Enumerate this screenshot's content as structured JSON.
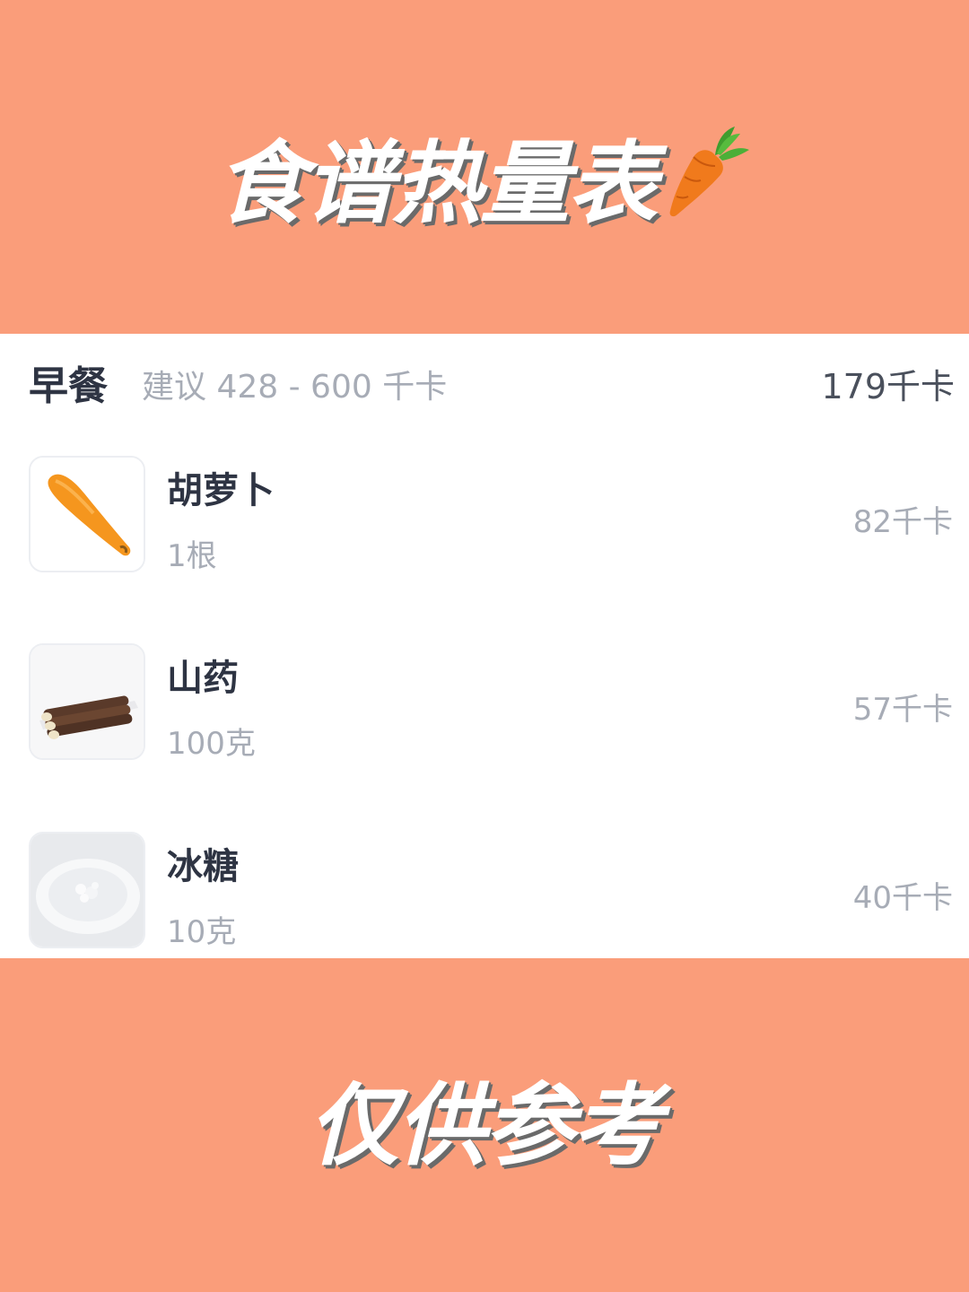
{
  "header": {
    "title": "食谱热量表",
    "title_icon": "carrot-icon"
  },
  "meal": {
    "name": "早餐",
    "suggestion": "建议 428 - 600 千卡",
    "total": "179千卡"
  },
  "foods": [
    {
      "name": "胡萝卜",
      "quantity": "1根",
      "calories": "82千卡",
      "image": "carrot-image"
    },
    {
      "name": "山药",
      "quantity": "100克",
      "calories": "57千卡",
      "image": "yam-image"
    },
    {
      "name": "冰糖",
      "quantity": "10克",
      "calories": "40千卡",
      "image": "rock-sugar-image"
    }
  ],
  "footer": {
    "text": "仅供参考"
  },
  "colors": {
    "background": "#fa9d7a",
    "panel": "#ffffff",
    "primary_text": "#2e3443",
    "secondary_text": "#a7acb6"
  }
}
